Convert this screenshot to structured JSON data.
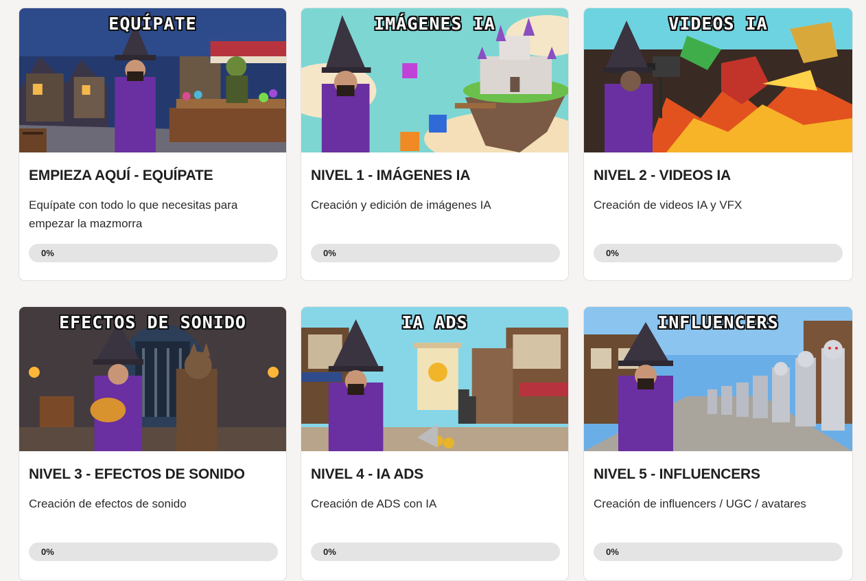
{
  "courses": [
    {
      "banner": "EQUÍPATE",
      "title": "EMPIEZA AQUÍ - EQUÍPATE",
      "description": "Equípate con todo lo que necesitas para empezar la mazmorra",
      "progress_label": "0%",
      "progress": 0,
      "image_subject": "wizard-shopping-at-goblin-market"
    },
    {
      "banner": "IMÁGENES IA",
      "title": "NIVEL 1 - IMÁGENES IA",
      "description": "Creación y edición de imágenes IA",
      "progress_label": "0%",
      "progress": 0,
      "image_subject": "wizard-with-floating-castle-island"
    },
    {
      "banner": "VIDEOS IA",
      "title": "NIVEL 2 - VIDEOS IA",
      "description": "Creación de videos IA y VFX",
      "progress_label": "0%",
      "progress": 0,
      "image_subject": "wizard-filming-fire-dragons"
    },
    {
      "banner": "EFECTOS DE SONIDO",
      "title": "NIVEL 3 - EFECTOS DE SONIDO",
      "description": "Creación de efectos de sonido",
      "progress_label": "0%",
      "progress": 0,
      "image_subject": "wizard-guitar-werewolf-violin-dungeon"
    },
    {
      "banner": "IA ADS",
      "title": "NIVEL 4 - IA ADS",
      "description": "Creación de ADS con IA",
      "progress_label": "0%",
      "progress": 0,
      "image_subject": "wizard-town-square-ad-scroll"
    },
    {
      "banner": "INFLUENCERS",
      "title": "NIVEL 5 - INFLUENCERS",
      "description": "Creación de influencers / UGC / avatares",
      "progress_label": "0%",
      "progress": 0,
      "image_subject": "wizard-with-robot-army-street"
    }
  ],
  "colors": {
    "page_background": "#f5f4f2",
    "card_background": "#ffffff",
    "progress_track": "#e4e4e4",
    "wizard_robe": "#6a2fa0"
  }
}
